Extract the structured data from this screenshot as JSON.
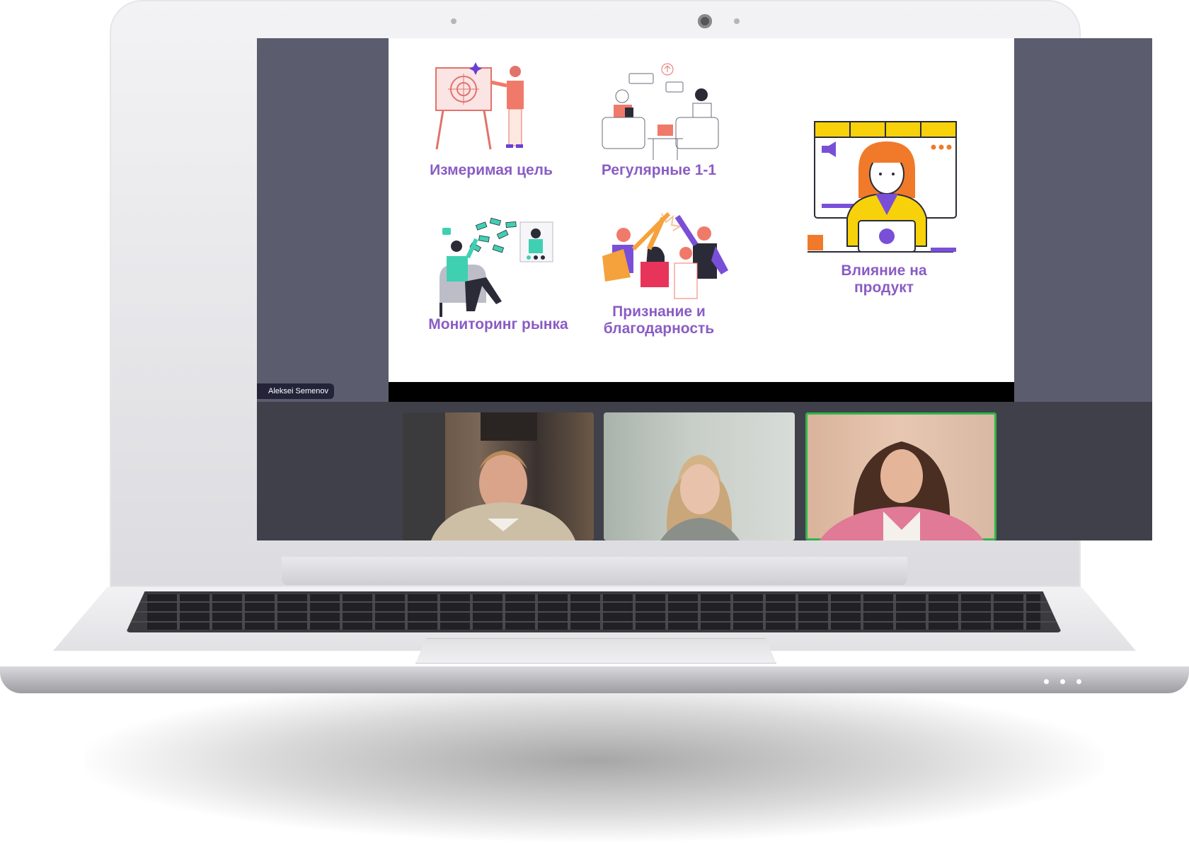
{
  "slide": {
    "items": [
      {
        "label": "Измеримая цель"
      },
      {
        "label": "Регулярные 1-1"
      },
      {
        "label": "Мониторинг рынка"
      },
      {
        "label_line1": "Признание и",
        "label_line2": "благодарность"
      },
      {
        "label_line1": "Влияние на",
        "label_line2": "продукт"
      }
    ]
  },
  "presenter": {
    "name": "Aleksei Semenov"
  },
  "participants": [
    {
      "id": "participant-1",
      "active": false
    },
    {
      "id": "participant-2",
      "active": false
    },
    {
      "id": "participant-3",
      "active": true
    }
  ],
  "colors": {
    "label_purple": "#8a5cc4",
    "active_speaker_border": "#2fb54a",
    "meeting_background": "#5b5d6e",
    "strip_background": "#3f4049"
  }
}
